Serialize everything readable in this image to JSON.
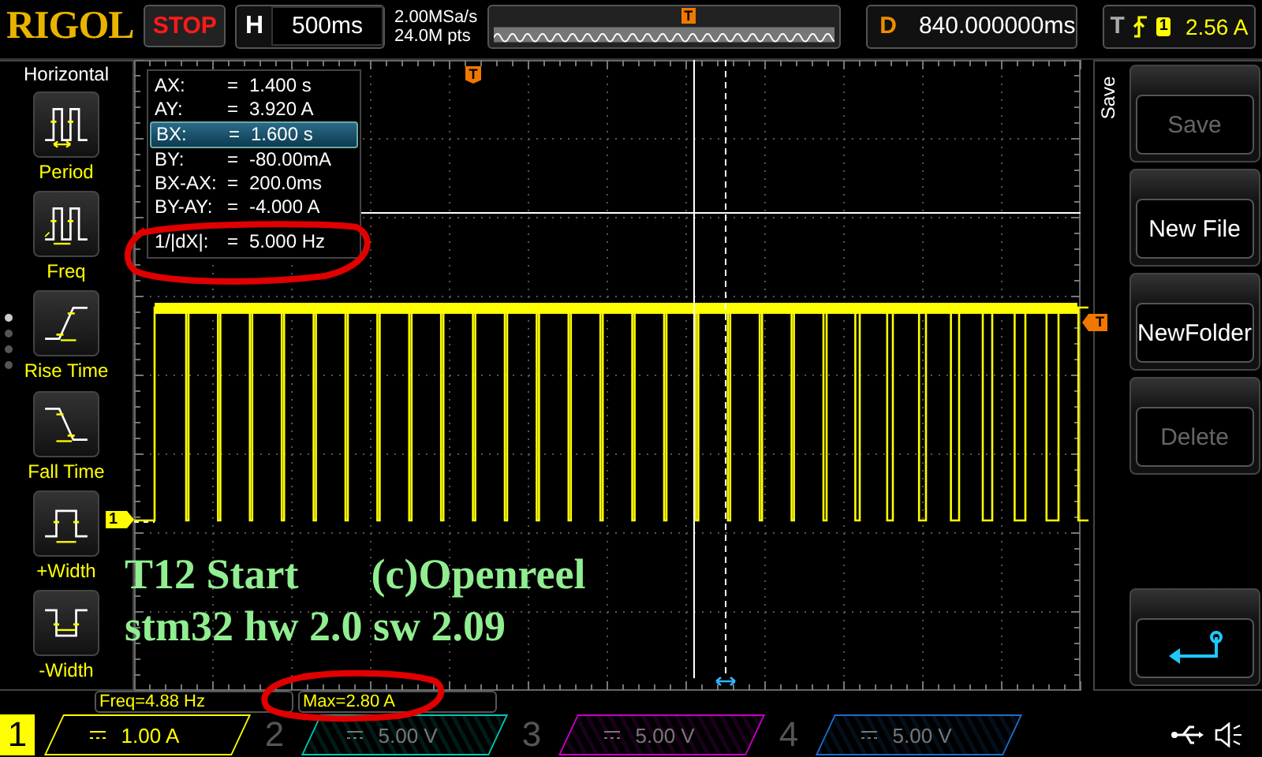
{
  "header": {
    "brand": "RIGOL",
    "run_state": "STOP",
    "timebase": {
      "label": "H",
      "value": "500ms"
    },
    "sample_rate": "2.00MSa/s",
    "memory_depth": "24.0M pts",
    "overview_marker": "T",
    "delay": {
      "label": "D",
      "value": "840.000000ms"
    },
    "trigger": {
      "label": "T",
      "channel": "1",
      "level": "2.56 A"
    }
  },
  "left_menu": {
    "title": "Horizontal",
    "items": [
      {
        "kind": "period",
        "label": "Period"
      },
      {
        "kind": "freq",
        "label": "Freq"
      },
      {
        "kind": "rise",
        "label": "Rise Time"
      },
      {
        "kind": "fall",
        "label": "Fall Time"
      },
      {
        "kind": "pwidth",
        "label": "+Width"
      },
      {
        "kind": "nwidth",
        "label": "-Width"
      }
    ]
  },
  "cursor_readout": [
    {
      "label": "AX:",
      "sign": "=",
      "value": "1.400 s",
      "selected": false
    },
    {
      "label": "AY:",
      "sign": "=",
      "value": "3.920 A",
      "selected": false
    },
    {
      "label": "BX:",
      "sign": "=",
      "value": "1.600 s",
      "selected": true
    },
    {
      "label": "BY:",
      "sign": "=",
      "value": "-80.00mA",
      "selected": false
    },
    {
      "label": "BX-AX:",
      "sign": "=",
      "value": "200.0ms",
      "selected": false
    },
    {
      "label": "BY-AY:",
      "sign": "=",
      "value": "-4.000 A",
      "selected": false
    },
    {
      "label": "1/|dX|:",
      "sign": "=",
      "value": "5.000 Hz",
      "selected": false
    }
  ],
  "plot_markers": {
    "trigger_position": "T",
    "channel": "1",
    "trigger_level": "T"
  },
  "overlay_text": [
    [
      "T12 Start",
      "(c)Openreel"
    ],
    [
      "stm32  hw 2.0 sw 2.09"
    ]
  ],
  "measurements": [
    {
      "text": "Freq=4.88 Hz"
    },
    {
      "text": "Max=2.80 A"
    }
  ],
  "channels": [
    {
      "number": "1",
      "scale": "1.00 A",
      "on": true,
      "color": "#ffff00"
    },
    {
      "number": "2",
      "scale": "5.00 V",
      "on": false,
      "color": "#00c8b4"
    },
    {
      "number": "3",
      "scale": "5.00 V",
      "on": false,
      "color": "#c800c8"
    },
    {
      "number": "4",
      "scale": "5.00 V",
      "on": false,
      "color": "#1e6ecd"
    }
  ],
  "save_menu": {
    "title": "Save",
    "buttons": [
      {
        "kind": "text",
        "label": "Save",
        "disabled": true
      },
      {
        "kind": "text",
        "label": "New File",
        "disabled": false
      },
      {
        "kind": "text",
        "label": "NewFolder",
        "disabled": false
      },
      {
        "kind": "text",
        "label": "Delete",
        "disabled": true
      },
      {
        "kind": "back"
      }
    ]
  }
}
